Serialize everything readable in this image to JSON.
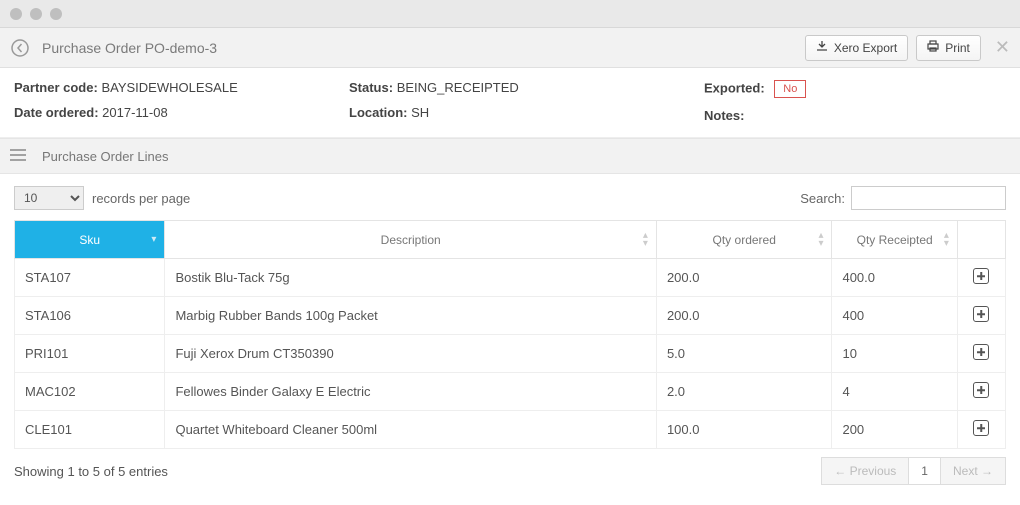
{
  "titlebar": {
    "title": "Purchase Order PO-demo-3",
    "xero_export": "Xero Export",
    "print": "Print"
  },
  "info": {
    "partner_code_label": "Partner code:",
    "partner_code_value": "BAYSIDEWHOLESALE",
    "date_ordered_label": "Date ordered:",
    "date_ordered_value": "2017-11-08",
    "status_label": "Status:",
    "status_value": "BEING_RECEIPTED",
    "location_label": "Location:",
    "location_value": "SH",
    "exported_label": "Exported:",
    "exported_value": "No",
    "notes_label": "Notes:"
  },
  "section": {
    "title": "Purchase Order Lines"
  },
  "controls": {
    "records_value": "10",
    "records_label": "records per page",
    "search_label": "Search:"
  },
  "table": {
    "headers": {
      "sku": "Sku",
      "description": "Description",
      "qty_ordered": "Qty ordered",
      "qty_receipted": "Qty Receipted"
    },
    "rows": [
      {
        "sku": "STA107",
        "description": "Bostik Blu-Tack 75g",
        "qty_ordered": "200.0",
        "qty_receipted": "400.0"
      },
      {
        "sku": "STA106",
        "description": "Marbig Rubber Bands 100g Packet",
        "qty_ordered": "200.0",
        "qty_receipted": "400"
      },
      {
        "sku": "PRI101",
        "description": "Fuji Xerox Drum CT350390",
        "qty_ordered": "5.0",
        "qty_receipted": "10"
      },
      {
        "sku": "MAC102",
        "description": "Fellowes Binder Galaxy E Electric",
        "qty_ordered": "2.0",
        "qty_receipted": "4"
      },
      {
        "sku": "CLE101",
        "description": "Quartet Whiteboard Cleaner 500ml",
        "qty_ordered": "100.0",
        "qty_receipted": "200"
      }
    ]
  },
  "footer": {
    "summary": "Showing 1 to 5 of 5 entries",
    "previous": "← Previous",
    "page": "1",
    "next": "Next →"
  }
}
